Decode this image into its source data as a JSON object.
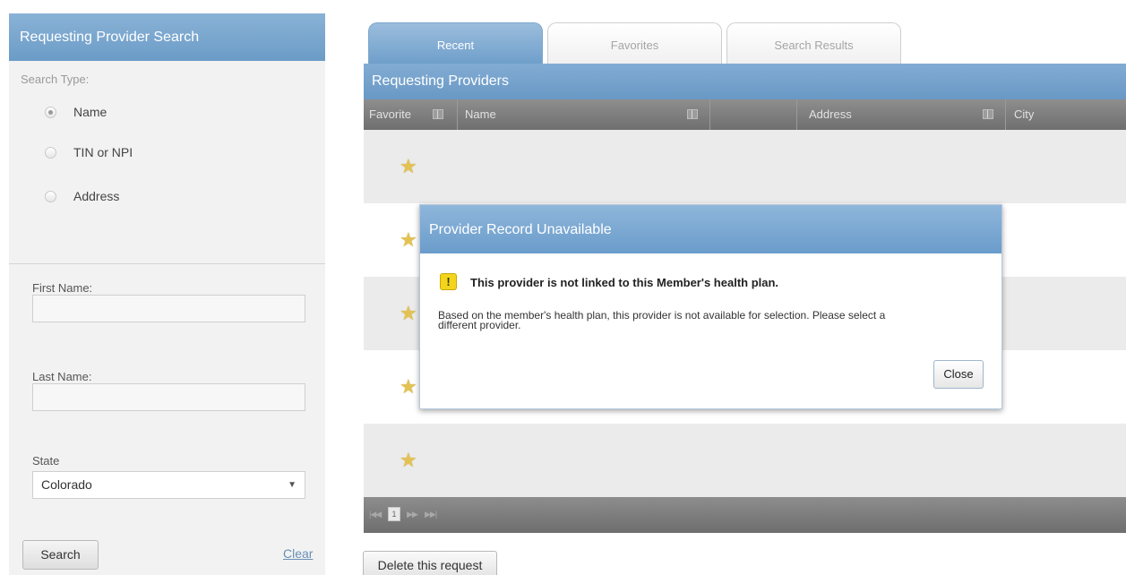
{
  "search_panel": {
    "title": "Requesting Provider Search",
    "search_type_label": "Search Type:",
    "search_types": [
      {
        "label": "Name",
        "selected": true
      },
      {
        "label": "TIN or NPI",
        "selected": false
      },
      {
        "label": "Address",
        "selected": false
      }
    ],
    "first_name_label": "First Name:",
    "first_name_value": "",
    "last_name_label": "Last Name:",
    "last_name_value": "",
    "state_label": "State",
    "state_value": "Colorado",
    "search_button": "Search",
    "clear_link": "Clear"
  },
  "tabs": [
    {
      "label": "Recent",
      "active": true
    },
    {
      "label": "Favorites",
      "active": false
    },
    {
      "label": "Search Results",
      "active": false
    }
  ],
  "results": {
    "title": "Requesting Providers",
    "columns": [
      "Favorite",
      "Name",
      "Address",
      "City"
    ],
    "favorite_rows": 5,
    "page_number": "1"
  },
  "delete_button": "Delete this request",
  "modal": {
    "title": "Provider Record Unavailable",
    "warning_symbol": "!",
    "heading": "This provider is not linked to this Member's health plan.",
    "message_line1": "Based on the member's health plan, this provider is not available for selection. Please select a",
    "message_line2": "different provider.",
    "close_button": "Close"
  },
  "icons": {
    "star": "star-icon",
    "warning": "warning-icon",
    "column_picker": "column-icon",
    "dropdown": "chevron-down-icon"
  },
  "colors": {
    "header_blue": "#6b9cc7",
    "grid_header_gray": "#7f7f7f",
    "star_gold": "#e3c253",
    "warning_yellow": "#f4d51d"
  }
}
